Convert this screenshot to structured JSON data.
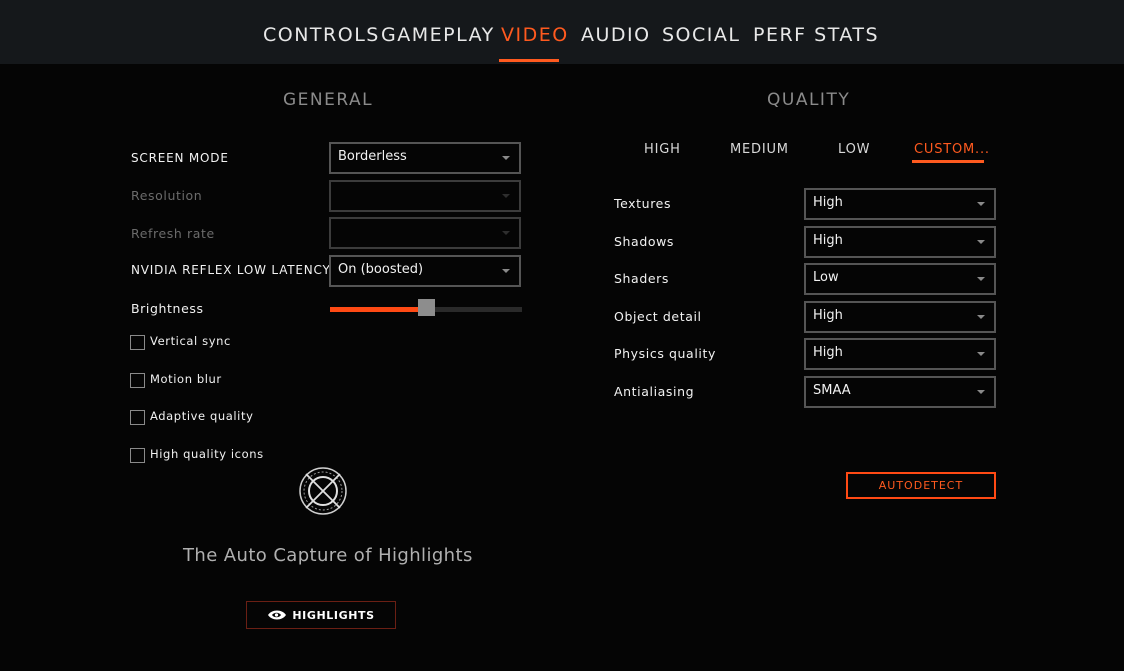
{
  "tabs": [
    {
      "label": "CONTROLS"
    },
    {
      "label": "GAMEPLAY"
    },
    {
      "label": "VIDEO",
      "active": true
    },
    {
      "label": "AUDIO"
    },
    {
      "label": "SOCIAL"
    },
    {
      "label": "PERF STATS"
    }
  ],
  "general": {
    "title": "GENERAL",
    "screen_mode": {
      "label": "SCREEN MODE",
      "value": "Borderless"
    },
    "resolution": {
      "label": "Resolution",
      "value": ""
    },
    "refresh_rate": {
      "label": "Refresh rate",
      "value": ""
    },
    "nvidia_reflex": {
      "label": "NVIDIA REFLEX LOW LATENCY",
      "value": "On (boosted)"
    },
    "brightness": {
      "label": "Brightness",
      "level": 0.5
    },
    "checkboxes": [
      {
        "label": "Vertical sync",
        "checked": false
      },
      {
        "label": "Motion blur",
        "checked": false
      },
      {
        "label": "Adaptive quality",
        "checked": false
      },
      {
        "label": "High quality icons",
        "checked": false
      }
    ],
    "highlights_caption": "The Auto Capture of Highlights",
    "highlights_button": "HIGHLIGHTS"
  },
  "quality": {
    "title": "QUALITY",
    "presets": [
      {
        "label": "HIGH"
      },
      {
        "label": "MEDIUM"
      },
      {
        "label": "LOW"
      },
      {
        "label": "CUSTOM...",
        "active": true
      }
    ],
    "settings": [
      {
        "label": "Textures",
        "value": "High"
      },
      {
        "label": "Shadows",
        "value": "High"
      },
      {
        "label": "Shaders",
        "value": "Low"
      },
      {
        "label": "Object detail",
        "value": "High"
      },
      {
        "label": "Physics quality",
        "value": "High"
      },
      {
        "label": "Antialiasing",
        "value": "SMAA"
      }
    ],
    "autodetect_button": "AUTODETECT"
  },
  "colors": {
    "accent": "#ff5a1f",
    "background": "#050505",
    "topbar": "#15181b"
  }
}
